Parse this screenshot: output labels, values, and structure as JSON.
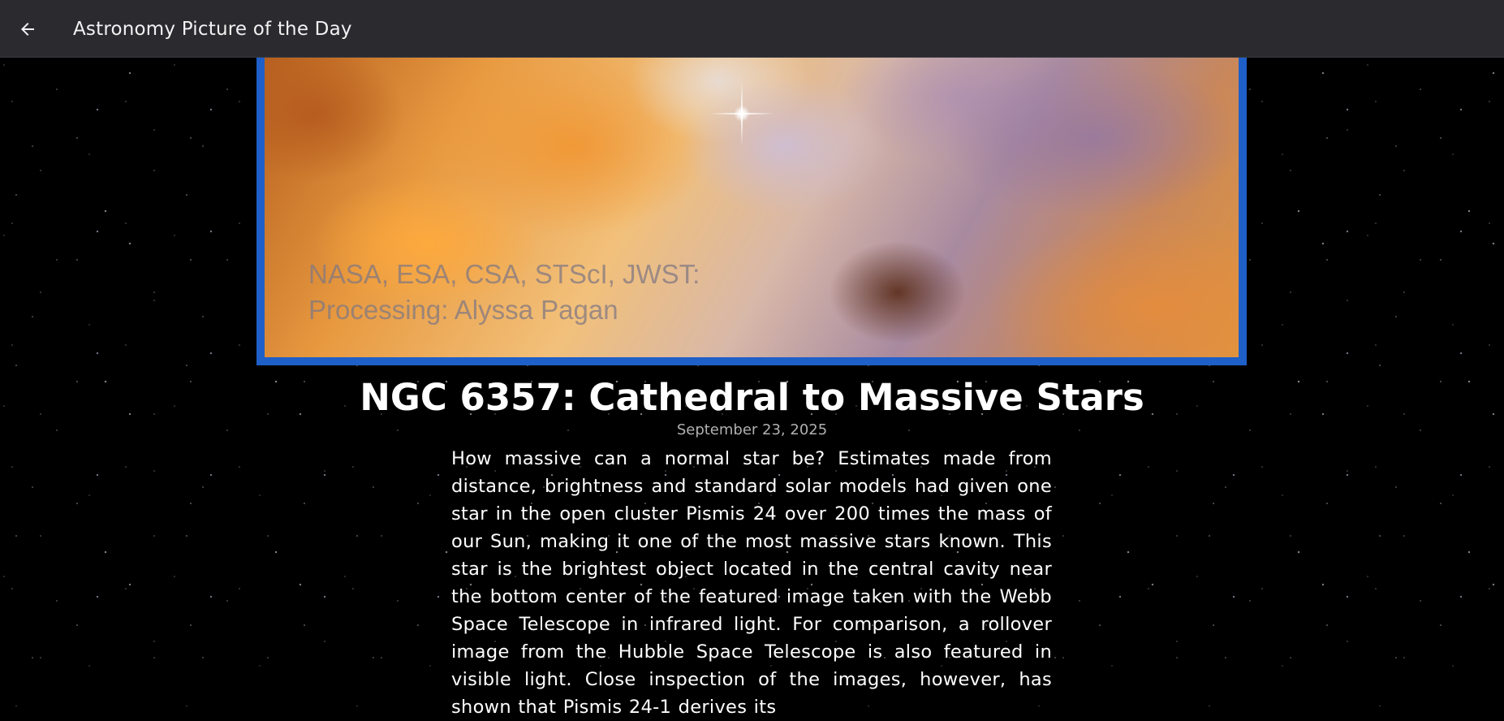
{
  "topbar": {
    "title": "Astronomy Picture of the Day",
    "back_icon": "arrow-left-icon"
  },
  "image": {
    "credit_line_1": "NASA, ESA, CSA, STScI, JWST:",
    "credit_line_2": "Processing: Alyssa Pagan",
    "frame_color": "#1f5fc8"
  },
  "article": {
    "title": "NGC 6357: Cathedral to Massive Stars",
    "date": "September 23, 2025",
    "explanation": "How massive can a normal star be? Estimates made from distance, brightness and standard solar models had given one star in the open cluster Pismis 24 over 200 times the mass of our Sun, making it one of the most massive stars known. This star is the brightest object located in the central cavity near the bottom center of the featured image taken with the Webb Space Telescope in infrared light. For comparison, a rollover image from the Hubble Space Telescope is also featured in visible light. Close inspection of the images, however, has shown that Pismis 24-1 derives its"
  },
  "colors": {
    "topbar_bg": "#2a2a2f",
    "background": "#000000",
    "title_text": "#ffffff",
    "date_text": "#b0b0b0"
  }
}
